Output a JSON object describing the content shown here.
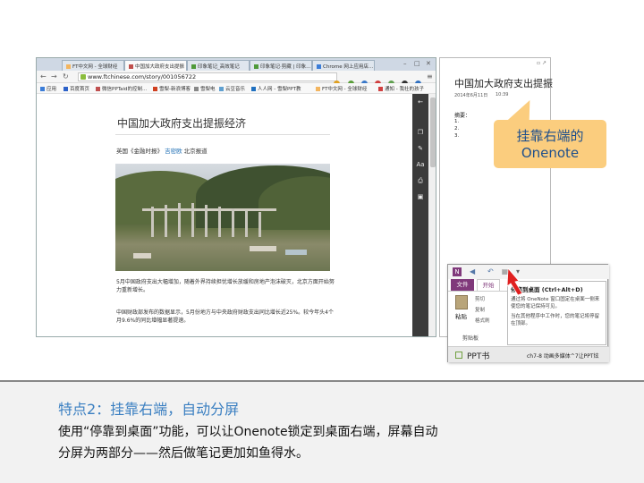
{
  "browser": {
    "tabs": [
      "FT中文网 - 全球财经",
      "中国加大政府支出提振",
      "印象笔记_高效笔记",
      "印象笔记·剪藏 | 印象...",
      "Chrome 网上应用店..."
    ],
    "url": "www.ftchinese.com/story/001056722",
    "bookmarks": [
      "应用",
      "百度首页",
      "微信PPTaid的控制...",
      "雪梨-新浪博客",
      "雪梨电",
      "云豆音乐",
      "人人网 - 雪梨PPT教",
      "FT中文网 - 全球财经",
      "通知 - 我社的孩子"
    ]
  },
  "article": {
    "title": "中国加大政府支出提振经济",
    "byline_prefix": "英国《金融时报》",
    "author": "吉密欧",
    "byline_suffix": "北京报道",
    "para1": "5月中国政府支出大幅增加，随着外界持续担忧增长放缓和房地产泡沫破灭，北京方面开始努力重新增长。",
    "para2": "中国财政部发布的数据显示，5月份地方与中央政府财政支出同比增长近25%。较今年头4个月9.6%的同比增幅显著提速。"
  },
  "reader_bar": {
    "icons": [
      "back-icon",
      "copy-icon",
      "highlight-icon",
      "font-size-icon",
      "print-icon",
      "comment-icon"
    ],
    "font_label": "Aa"
  },
  "onenote": {
    "page_title": "中国加大政府支出提振",
    "date": "2014年6月11日",
    "time": "10:39",
    "summary_label": "摘要：",
    "items": [
      "1.",
      "2.",
      "3."
    ]
  },
  "callout": {
    "line1": "挂靠右端的",
    "line2": "Onenote"
  },
  "ribbon": {
    "logo": "N",
    "file_tab": "文件",
    "home_tab": "开始",
    "paste": "粘贴",
    "cut": "剪切",
    "copy": "复制",
    "format_painter": "格式刷",
    "clipboard": "剪贴板",
    "tooltip_title": "停靠到桌面 (Ctrl+Alt+D)",
    "tooltip_body1": "通过将 OneNote 窗口固定在桌面一侧来使您的笔记保持可见。",
    "tooltip_body2": "当在其他程序中工作时，您的笔记将停留在顶部。",
    "notebook": "PPT书",
    "section": "ch7-8 动画多媒体^7让PPT炫"
  },
  "bottom": {
    "heading": "特点2：挂靠右端，自动分屏",
    "line1": "使用“停靠到桌面”功能，可以让Onenote锁定到桌面右端，屏幕自动",
    "line2": "分屏为两部分——然后做笔记更加如鱼得水。"
  },
  "colors": {
    "accent_blue": "#3a7fc1",
    "callout_bg": "#fbcd7e",
    "onenote_purple": "#80397b",
    "arrow_red": "#e02020"
  }
}
